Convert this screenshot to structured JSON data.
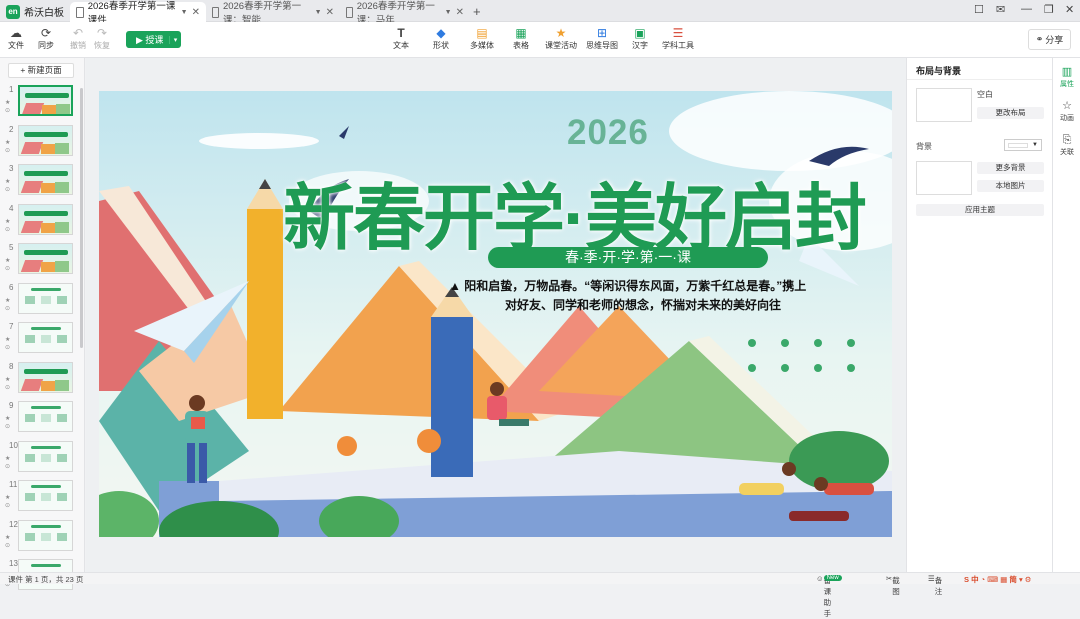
{
  "app": {
    "name": "希沃白板"
  },
  "tabs": [
    {
      "label": "2026春季开学第一课 课件",
      "active": true
    },
    {
      "label": "2026春季开学第一课：智能..."
    },
    {
      "label": "2026春季开学第一课：马年..."
    }
  ],
  "toolbar": {
    "file": "文件",
    "sync": "同步",
    "undo": "撤销",
    "redo": "恢复",
    "play": "授课",
    "tools": [
      "文本",
      "形状",
      "多媒体",
      "表格",
      "课堂活动",
      "思维导图",
      "汉字",
      "学科工具"
    ],
    "share": "分享"
  },
  "left_panel": {
    "new_page": "+ 新建页面",
    "slides": [
      "1",
      "2",
      "3",
      "4",
      "5",
      "6",
      "7",
      "8",
      "9",
      "10",
      "11",
      "12",
      "13"
    ]
  },
  "slide": {
    "year": "2026",
    "title": "新春开学·美好启封",
    "subtitle": "春·季·开·学·第·一·课",
    "body_line1": "阳和启蛰，万物品春。“等闲识得东风面，万紫千红总是春。”携上",
    "body_line2": "对好友、同学和老师的想念，怀揣对未来的美好向往"
  },
  "right_panel": {
    "title": "布局与背景",
    "blank": "空白",
    "change_layout": "更改布局",
    "background": "背景",
    "more_bg": "更多背景",
    "local_image": "本地图片",
    "apply_theme": "应用主题"
  },
  "rail": [
    "属性",
    "动画",
    "关联"
  ],
  "status": {
    "page_info": "课件 第 1 页，共 23 页",
    "assistant": "备课助手",
    "badge": "New",
    "screenshot": "截图",
    "notes": "备注"
  },
  "colors": {
    "accent": "#1aa35a",
    "title_green": "#1f9b54"
  }
}
